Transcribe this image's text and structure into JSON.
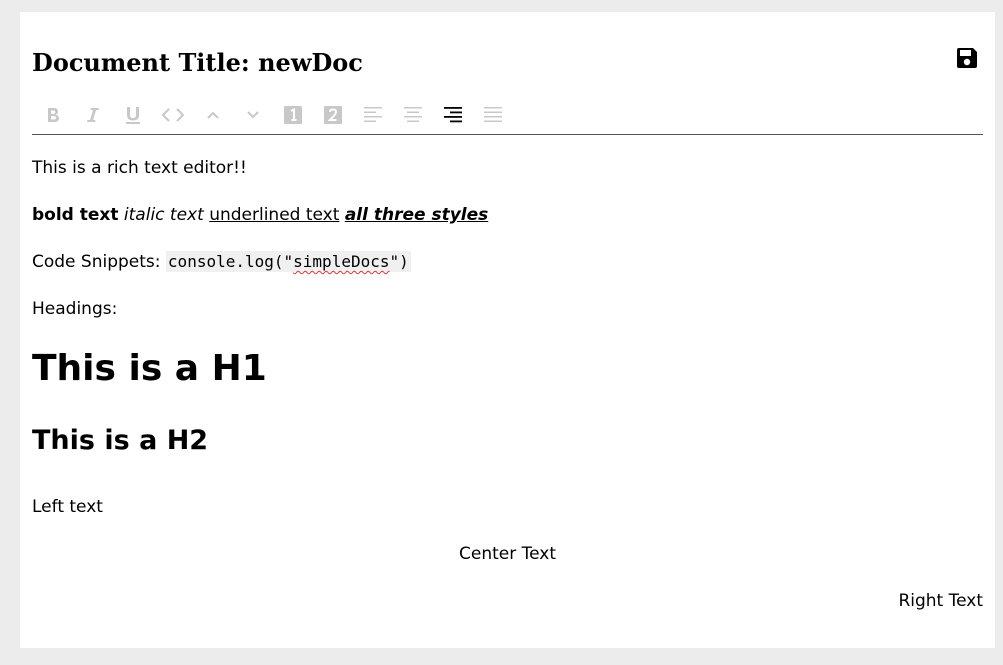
{
  "document": {
    "title_prefix": "Document Title:",
    "title_name": "newDoc"
  },
  "toolbar": {
    "buttons": [
      {
        "name": "bold-button",
        "icon": "bold-icon",
        "glyph": "B"
      },
      {
        "name": "italic-button",
        "icon": "italic-icon",
        "glyph": "I"
      },
      {
        "name": "underline-button",
        "icon": "underline-icon",
        "glyph": "U"
      },
      {
        "name": "code-button",
        "icon": "code-icon",
        "glyph": "<>"
      },
      {
        "name": "heading-one-up-button",
        "icon": "chevron-up-icon",
        "glyph": "^"
      },
      {
        "name": "heading-down-button",
        "icon": "chevron-down-icon",
        "glyph": "v"
      },
      {
        "name": "numbered-one-button",
        "icon": "number-one-icon",
        "glyph": "1"
      },
      {
        "name": "numbered-two-button",
        "icon": "number-two-icon",
        "glyph": "2"
      },
      {
        "name": "align-left-button",
        "icon": "align-left-icon"
      },
      {
        "name": "align-center-button",
        "icon": "align-center-icon"
      },
      {
        "name": "align-right-button",
        "icon": "align-right-icon",
        "active": true
      },
      {
        "name": "align-justify-button",
        "icon": "align-justify-icon"
      }
    ],
    "inactive_color": "#c8c8c8",
    "active_color": "#000000"
  },
  "content": {
    "intro": "This is a rich text editor!!",
    "bold_text": "bold text",
    "italic_text": "italic text",
    "underlined_text": "underlined text",
    "all_three": "all three styles",
    "code_label": "Code Snippets:",
    "code_prefix": "console.log(\"",
    "code_word": "simpleDocs",
    "code_suffix": "\")",
    "headings_label": "Headings:",
    "h1": "This is a H1",
    "h2": "This is a H2",
    "left_text": "Left text",
    "center_text": "Center Text",
    "right_text": "Right Text"
  },
  "icons": {
    "save": "floppy-disk-icon"
  }
}
